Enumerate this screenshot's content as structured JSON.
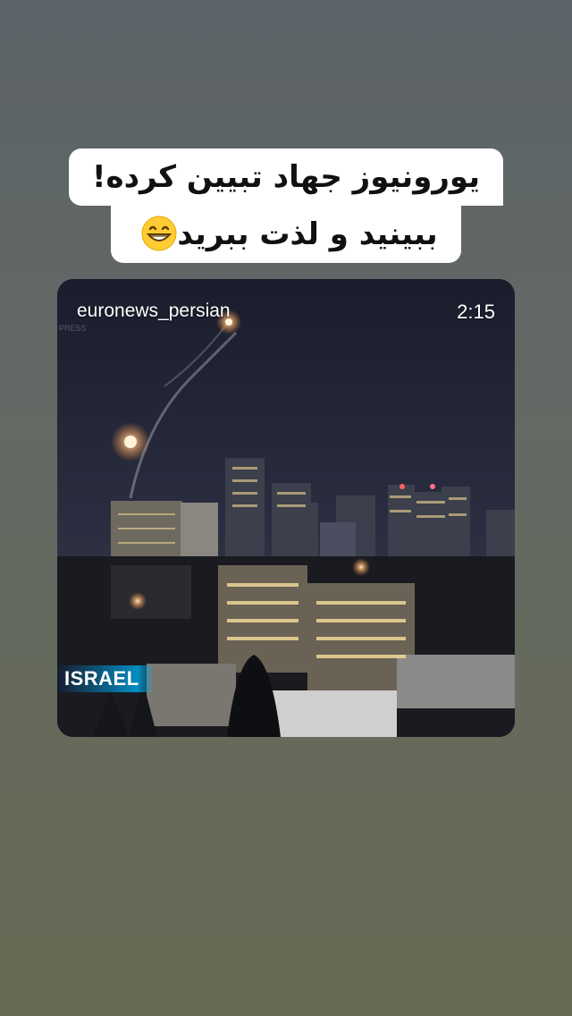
{
  "story": {
    "caption_line_1": "یورونیوز جهاد تبیین کرده!",
    "caption_line_2": "ببینید و لذت ببرید",
    "caption_emoji": "grinning-face-emoji"
  },
  "video_post": {
    "username": "euronews_persian",
    "duration": "2:15",
    "watermark": "PRESS",
    "location_tag": "ISRAEL"
  }
}
